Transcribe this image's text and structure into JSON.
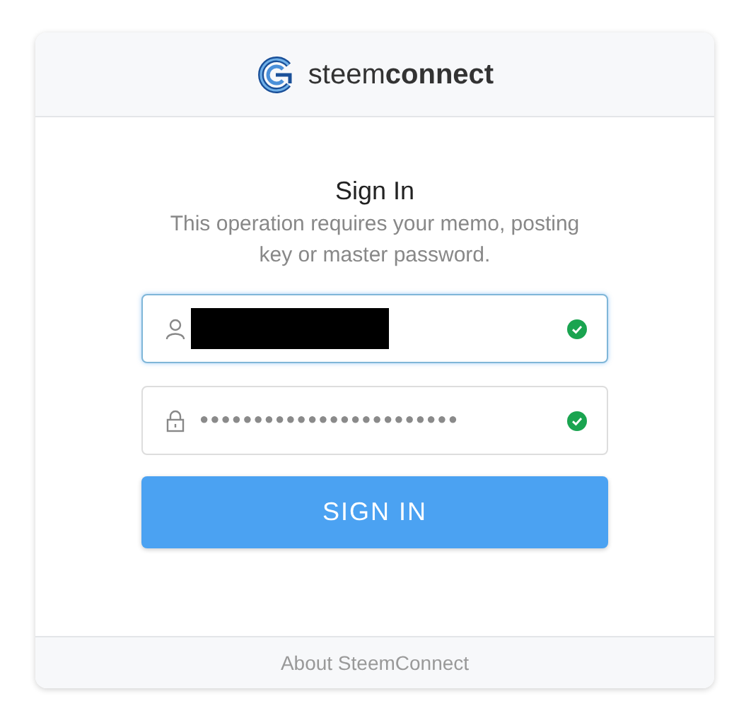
{
  "header": {
    "logo_text": "steem**connect**"
  },
  "title": "Sign In",
  "subtitle": "This operation requires your memo, posting key or master password.",
  "fields": [
    {
      "kind": "username",
      "redacted": true,
      "focused": true,
      "valid": true
    },
    {
      "kind": "password",
      "value": "●●●●●●●●●●●●●●●●●●●●●●●●",
      "focused": false,
      "valid": true
    }
  ],
  "submit": {
    "label": "SIGN IN"
  },
  "footer": {
    "link": "About SteemConnect"
  }
}
